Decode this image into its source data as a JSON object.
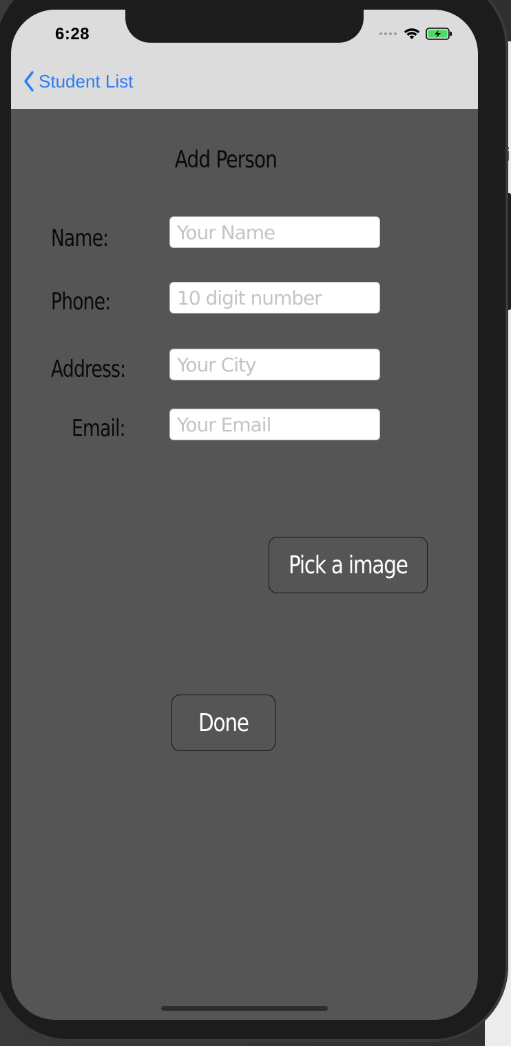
{
  "status_bar": {
    "time": "6:28"
  },
  "nav": {
    "back_label": "Student List",
    "accent": "#2f7cf6"
  },
  "form": {
    "title": "Add Person",
    "fields": [
      {
        "label": "Name:",
        "placeholder": "Your Name",
        "value": ""
      },
      {
        "label": "Phone:",
        "placeholder": "10 digit number",
        "value": ""
      },
      {
        "label": "Address:",
        "placeholder": "Your City",
        "value": ""
      },
      {
        "label": "Email:",
        "placeholder": "Your Email",
        "value": ""
      }
    ]
  },
  "buttons": {
    "pick_image": "Pick a image",
    "done": "Done"
  },
  "icons": [
    "chevron-left-icon",
    "cellular-signal-icon",
    "wifi-icon",
    "battery-charging-icon"
  ],
  "colors": {
    "screen_bg": "#555555",
    "nav_bg": "#dcdcdc"
  }
}
